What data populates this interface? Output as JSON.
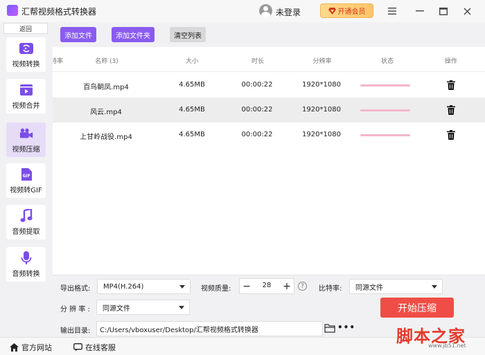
{
  "window": {
    "title": "汇帮视频格式转换器",
    "login_text": "未登录",
    "vip_label": "开通会员"
  },
  "sidebar": {
    "back_label": "返回",
    "items": [
      {
        "label": "视频转换",
        "icon": "video-convert-icon",
        "active": false
      },
      {
        "label": "视频合并",
        "icon": "video-merge-icon",
        "active": false
      },
      {
        "label": "视频压缩",
        "icon": "camera-compress-icon",
        "active": true
      },
      {
        "label": "视频转GIF",
        "icon": "gif-icon",
        "active": false
      },
      {
        "label": "音频提取",
        "icon": "music-note-icon",
        "active": false
      },
      {
        "label": "音频转换",
        "icon": "microphone-icon",
        "active": false
      }
    ]
  },
  "toolbar": {
    "add_file": "添加文件",
    "add_folder": "添加文件夹",
    "clear_list": "清空列表"
  },
  "table": {
    "headers": {
      "bitrate": "特率",
      "name": "名称 (3)",
      "size": "大小",
      "duration": "时长",
      "resolution": "分辨率",
      "status": "状态",
      "action": "操作"
    },
    "rows": [
      {
        "name": "百鸟朝凤.mp4",
        "size": "4.65MB",
        "duration": "00:00:22",
        "resolution": "1920*1080",
        "progress": 0
      },
      {
        "name": "风云.mp4",
        "size": "4.65MB",
        "duration": "00:00:22",
        "resolution": "1920*1080",
        "progress": 0
      },
      {
        "name": "上甘岭战役.mp4",
        "size": "4.65MB",
        "duration": "00:00:22",
        "resolution": "1920*1080",
        "progress": 0
      }
    ]
  },
  "settings": {
    "format_label": "导出格式:",
    "format_value": "MP4(H.264)",
    "quality_label": "视频质量:",
    "quality_value": "28",
    "bitrate_label": "比特率:",
    "bitrate_value": "同源文件",
    "resolution_label": "分 辨 率 :",
    "resolution_value": "同源文件",
    "output_label": "输出目录:",
    "output_path": "C:/Users/vboxuser/Desktop/汇帮视频格式转换器",
    "start_label": "开始压缩"
  },
  "statusbar": {
    "website": "官方网站",
    "support": "在线客服"
  },
  "watermark": {
    "text": "脚本之家",
    "url": "www.jb51.net"
  },
  "colors": {
    "accent": "#8a5bf0",
    "start": "#ef4e46",
    "progress_track": "#f4b6c9"
  }
}
